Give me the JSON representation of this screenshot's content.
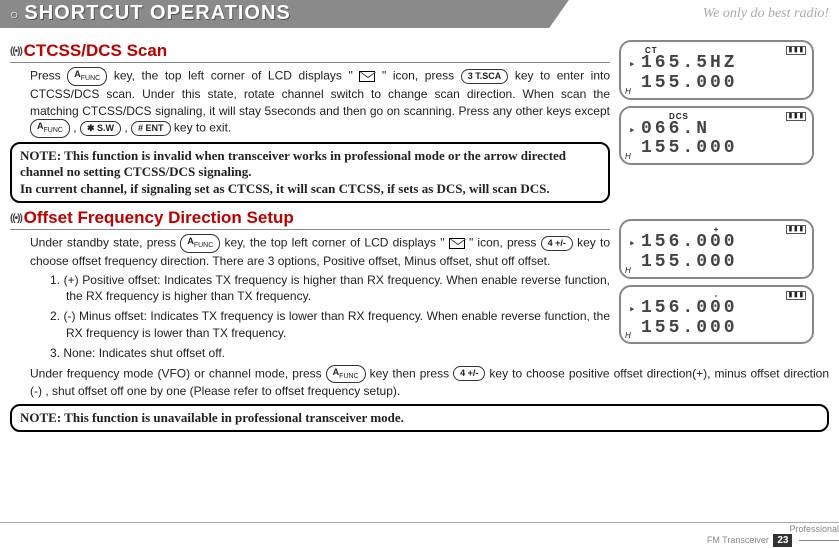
{
  "header": {
    "title": "SHORTCUT OPERATIONS",
    "tagline": "We only do best radio!"
  },
  "section1": {
    "heading": "CTCSS/DCS Scan",
    "p1a": "Press ",
    "p1b": " key, the top left corner of LCD displays \" ",
    "p1c": " \" icon, press ",
    "p1d": " key to enter into CTCSS/DCS scan. Under this state, rotate channel switch to change scan direction. When scan the matching CTCSS/DCS signaling, it will stay 5seconds and then go on scanning. Press any other keys except ",
    "p1e": " , ",
    "p1f": " , ",
    "p1g": " key to exit.",
    "key_a": "A",
    "key_a_sub": "FUNC",
    "key_3": "3 T.SCA",
    "key_star": "✱ S.W",
    "key_hash": "# ENT",
    "note_bold1": "NOTE: This function is invalid when transceiver works in professional mode or the arrow directed channel no setting CTCSS/DCS signaling.",
    "note_bold2": "In current channel, if signaling set as CTCSS, it will scan CTCSS, if sets as DCS, will scan DCS."
  },
  "section2": {
    "heading": "Offset Frequency Direction Setup",
    "p1a": "Under standby state, press ",
    "p1b": " key, the top left corner of LCD displays \" ",
    "p1c": " \" icon, press ",
    "p1d": " key to choose offset frequency direction. There are 3 options, Positive offset, Minus offset, shut off offset.",
    "key_4": "4 +/-",
    "li1": "1. (+) Positive offset: Indicates TX frequency is higher than RX frequency. When enable reverse function, the RX frequency is higher than TX frequency.",
    "li2": "2. (-) Minus offset: Indicates TX frequency is lower than RX frequency. When enable reverse function, the RX frequency is lower than TX frequency.",
    "li3": "3. None: Indicates shut offset off.",
    "p2a": "Under frequency mode (VFO) or channel mode, press ",
    "p2b": " key then press ",
    "p2c": " key to choose positive offset direction(+), minus offset direction (-) , shut offset off one by one (Please refer to offset frequency setup).",
    "note": "NOTE: This function is unavailable in professional transceiver mode."
  },
  "lcd1": {
    "ind": "CT",
    "line1": "165.5HZ",
    "line2": "155.000",
    "corner": "H"
  },
  "lcd2": {
    "ind": "DCS",
    "line1": "066.N",
    "line2": "155.000",
    "corner": "H"
  },
  "lcd3": {
    "ind": "+",
    "line1": "156.000",
    "line2": "155.000",
    "corner": "H"
  },
  "lcd4": {
    "ind": "-",
    "line1": "156.000",
    "line2": "155.000",
    "corner": "H"
  },
  "footer": {
    "text1": "Professional",
    "text2": "FM Transceiver",
    "page": "23"
  }
}
